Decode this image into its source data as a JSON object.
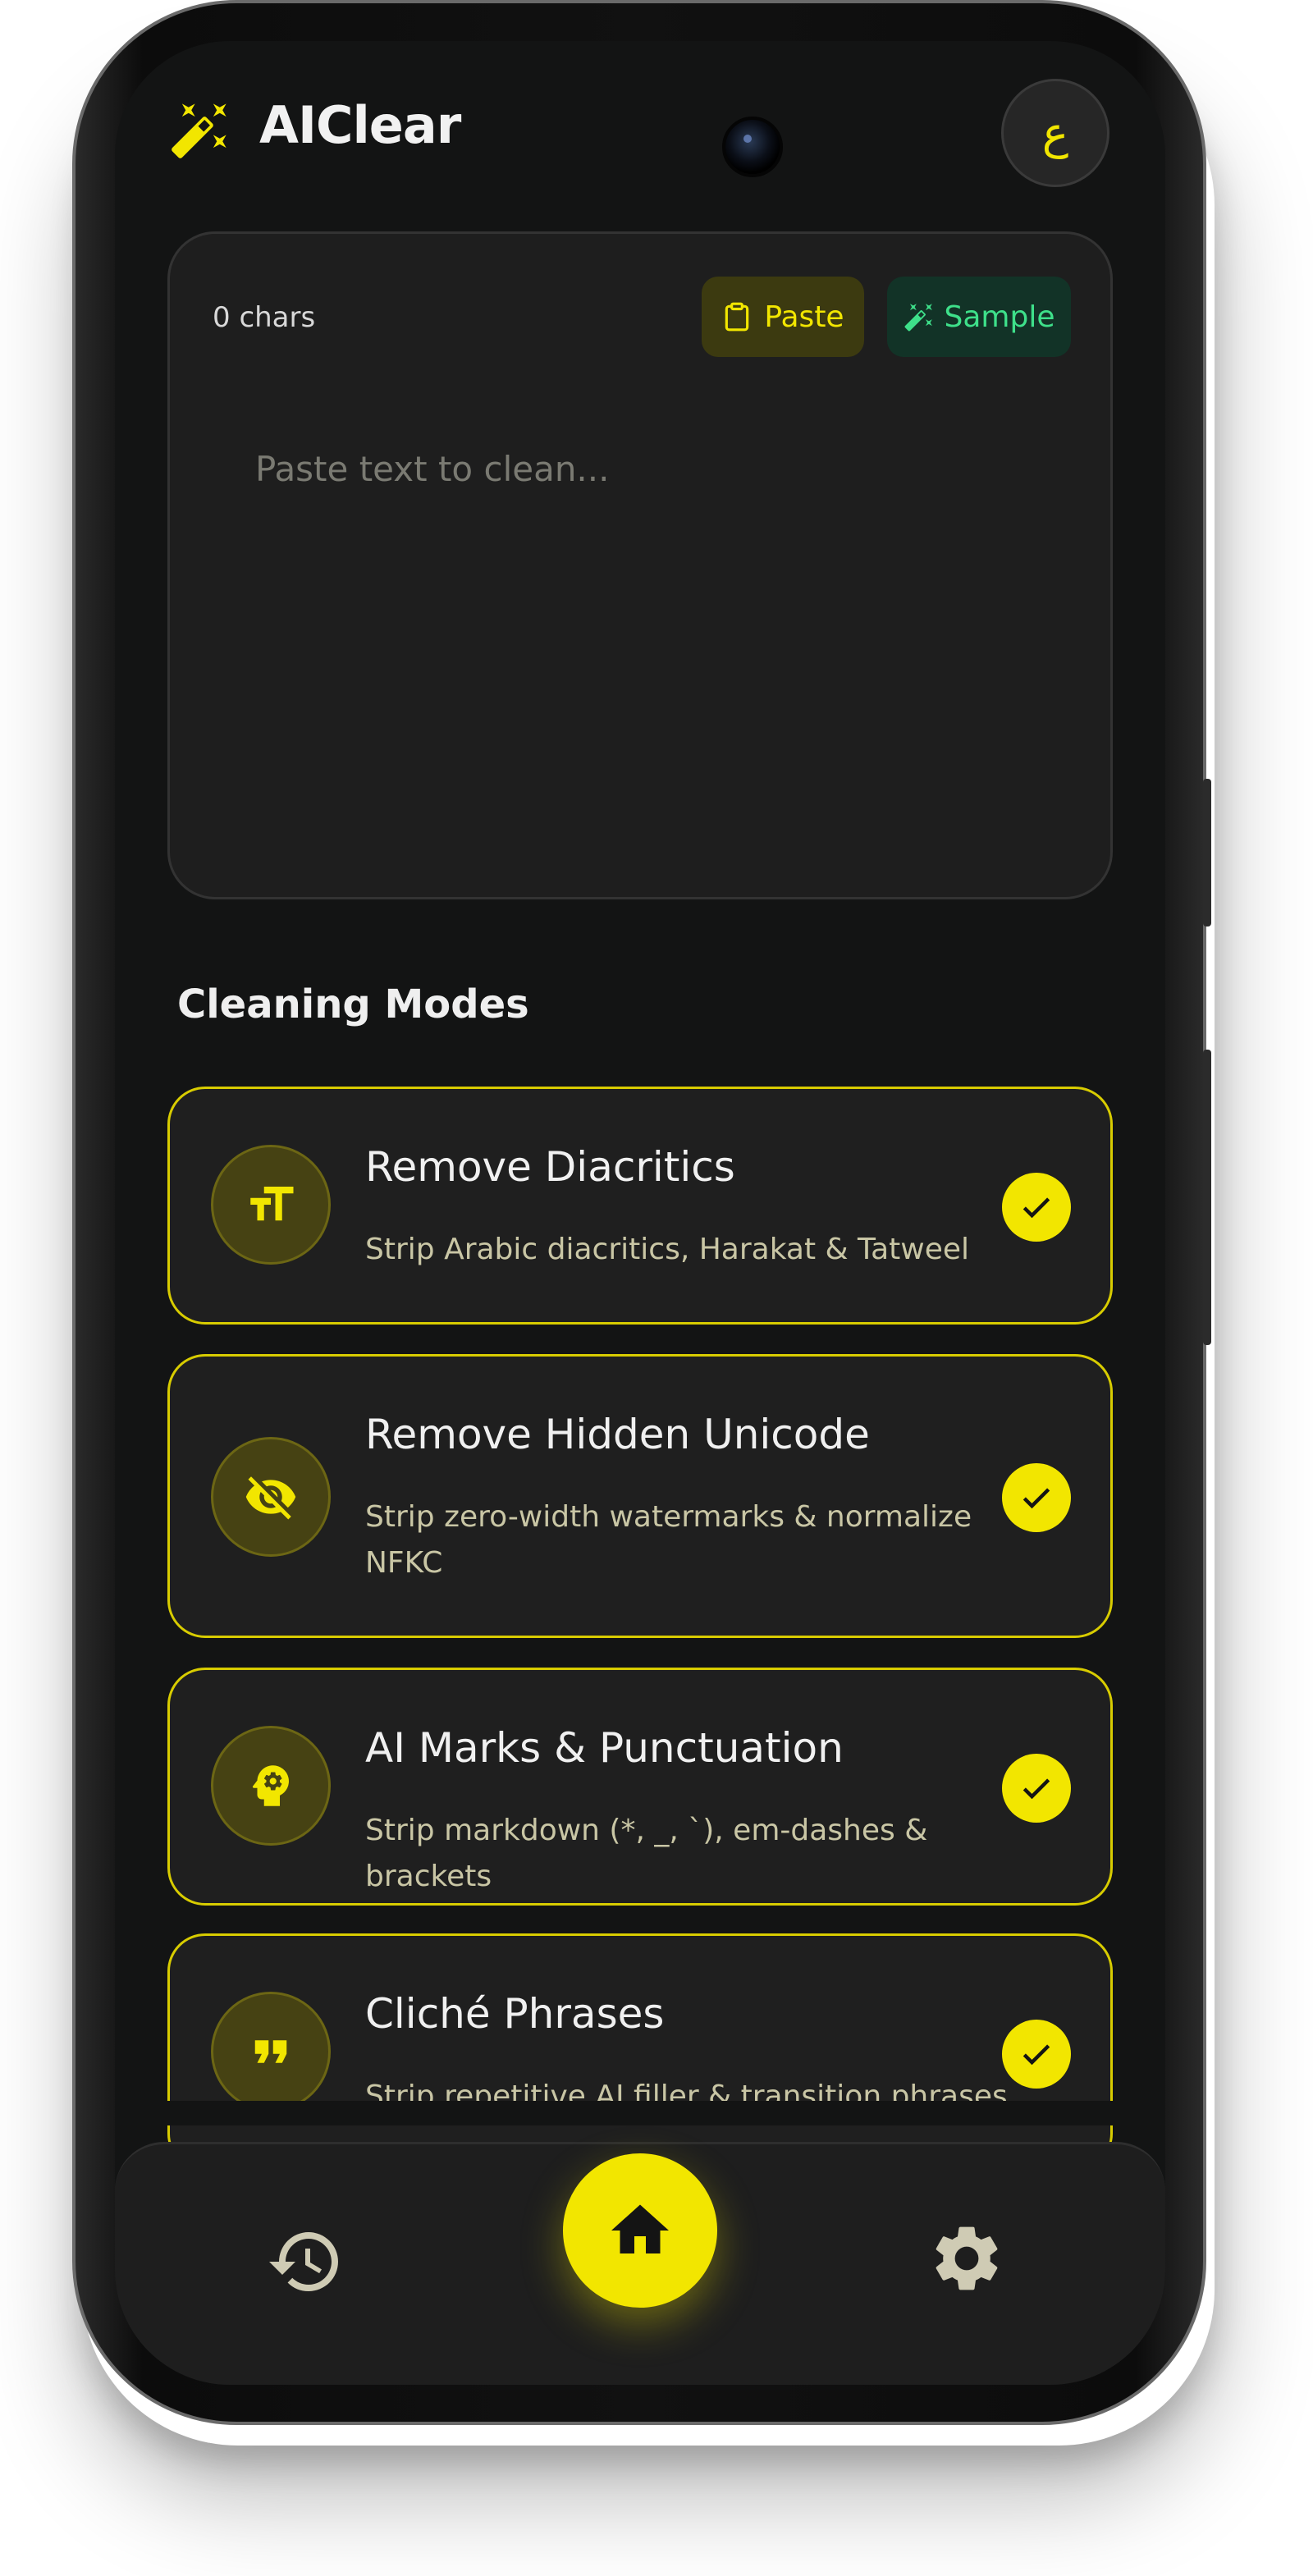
{
  "app": {
    "title": "AIClear",
    "lang_button": "ع"
  },
  "editor": {
    "char_count": "0 chars",
    "paste_label": "Paste",
    "sample_label": "Sample",
    "placeholder": "Paste text to clean..."
  },
  "modes": {
    "heading": "Cleaning Modes",
    "items": [
      {
        "title": "Remove Diacritics",
        "description": "Strip Arabic diacritics, Harakat & Tatweel",
        "icon": "text-size-icon",
        "checked": true
      },
      {
        "title": "Remove Hidden Unicode",
        "description": "Strip zero-width watermarks & normalize NFKC",
        "icon": "eye-off-icon",
        "checked": true
      },
      {
        "title": "AI Marks & Punctuation",
        "description": "Strip markdown (*, _, `), em-dashes & brackets",
        "icon": "psychology-head-icon",
        "checked": true
      },
      {
        "title": "Cliché Phrases",
        "description": "Strip repetitive AI filler & transition phrases",
        "icon": "quote-icon",
        "checked": true
      }
    ]
  },
  "nav": {
    "items": [
      "history-icon",
      "home-icon",
      "settings-icon"
    ],
    "active": "home-icon"
  },
  "colors": {
    "accent": "#f2e600",
    "sample": "#3ee08a",
    "background": "#131414",
    "card": "#1f1f1f"
  }
}
